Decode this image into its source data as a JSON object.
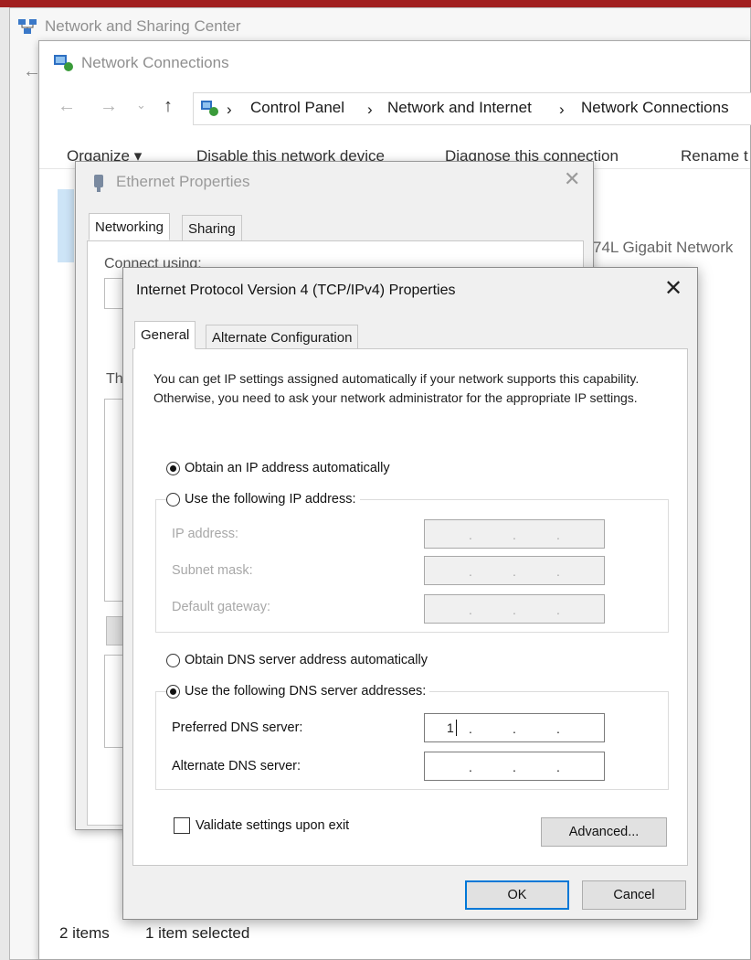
{
  "outer_window": {
    "title": "Network and Sharing Center"
  },
  "network_connections": {
    "title": "Network Connections",
    "breadcrumb": [
      "Control Panel",
      "Network and Internet",
      "Network Connections"
    ],
    "toolbar": {
      "organize": "Organize ▾",
      "disable": "Disable this network device",
      "diagnose": "Diagnose this connection",
      "rename": "Rename t"
    },
    "adapter_text": "74L Gigabit Network",
    "status": {
      "items": "2 items",
      "selected": "1 item selected"
    }
  },
  "ethernet_properties": {
    "title": "Ethernet Properties",
    "tabs": [
      "Networking",
      "Sharing"
    ],
    "connect_using_label": "Connect using:",
    "this_connection_label": "Th"
  },
  "ipv4_dialog": {
    "title": "Internet Protocol Version 4 (TCP/IPv4) Properties",
    "tabs": [
      "General",
      "Alternate Configuration"
    ],
    "description": "You can get IP settings assigned automatically if your network supports this capability. Otherwise, you need to ask your network administrator for the appropriate IP settings.",
    "ip_options": {
      "auto": "Obtain an IP address automatically",
      "manual": "Use the following IP address:"
    },
    "ip_fields": {
      "ip_address": "IP address:",
      "subnet_mask": "Subnet mask:",
      "default_gateway": "Default gateway:"
    },
    "dns_options": {
      "auto": "Obtain DNS server address automatically",
      "manual": "Use the following DNS server addresses:"
    },
    "dns_fields": {
      "preferred": "Preferred DNS server:",
      "preferred_value": "1",
      "alternate": "Alternate DNS server:"
    },
    "validate_label": "Validate settings upon exit",
    "buttons": {
      "advanced": "Advanced...",
      "ok": "OK",
      "cancel": "Cancel"
    },
    "selected_ip_option": "auto",
    "selected_dns_option": "manual",
    "validate_checked": false
  }
}
